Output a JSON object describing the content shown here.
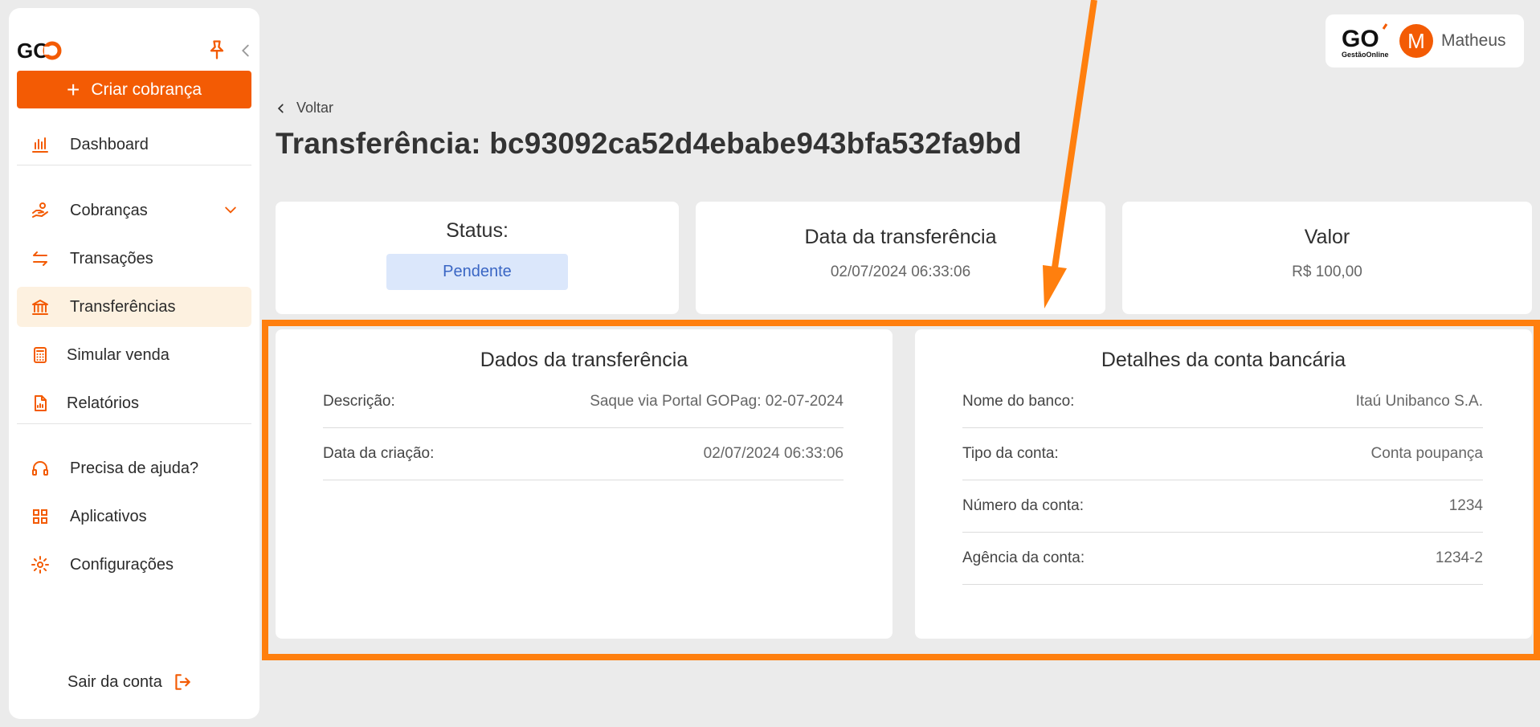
{
  "brand": {
    "logo_text": "GO",
    "sub_text": "GestãoOnline"
  },
  "colors": {
    "accent": "#f35b04",
    "highlight": "#ff7f0e",
    "status_bg": "#dbe7fb",
    "status_fg": "#3a66c4",
    "active_bg": "#fdf1e0"
  },
  "sidebar": {
    "create_label": "Criar cobrança",
    "items": [
      {
        "label": "Dashboard",
        "icon": "bar-chart-icon"
      },
      {
        "label": "Cobranças",
        "icon": "hand-money-icon"
      },
      {
        "label": "Transações",
        "icon": "swap-arrows-icon"
      },
      {
        "label": "Transferências",
        "icon": "bank-icon",
        "active": true
      },
      {
        "label": "Simular venda",
        "icon": "calculator-icon"
      },
      {
        "label": "Relatórios",
        "icon": "report-icon"
      },
      {
        "label": "Precisa de ajuda?",
        "icon": "headset-icon"
      },
      {
        "label": "Aplicativos",
        "icon": "apps-grid-icon"
      },
      {
        "label": "Configurações",
        "icon": "gear-icon"
      }
    ],
    "logout_label": "Sair da conta"
  },
  "profile": {
    "initial": "M",
    "name": "Matheus"
  },
  "header": {
    "back_label": "Voltar",
    "title": "Transferência: bc93092ca52d4ebabe943bfa532fa9bd"
  },
  "stats": {
    "status_label": "Status:",
    "status_value": "Pendente",
    "date_label": "Data da transferência",
    "date_value": "02/07/2024 06:33:06",
    "amount_label": "Valor",
    "amount_value": "R$ 100,00"
  },
  "transfer_data": {
    "title": "Dados da transferência",
    "rows": [
      {
        "key": "Descrição:",
        "value": "Saque via Portal GOPag: 02-07-2024"
      },
      {
        "key": "Data da criação:",
        "value": "02/07/2024 06:33:06"
      }
    ]
  },
  "bank_details": {
    "title": "Detalhes da conta bancária",
    "rows": [
      {
        "key": "Nome do banco:",
        "value": "Itaú Unibanco S.A."
      },
      {
        "key": "Tipo da conta:",
        "value": "Conta poupança"
      },
      {
        "key": "Número da conta:",
        "value": "1234"
      },
      {
        "key": "Agência da conta:",
        "value": "1234-2"
      }
    ]
  }
}
